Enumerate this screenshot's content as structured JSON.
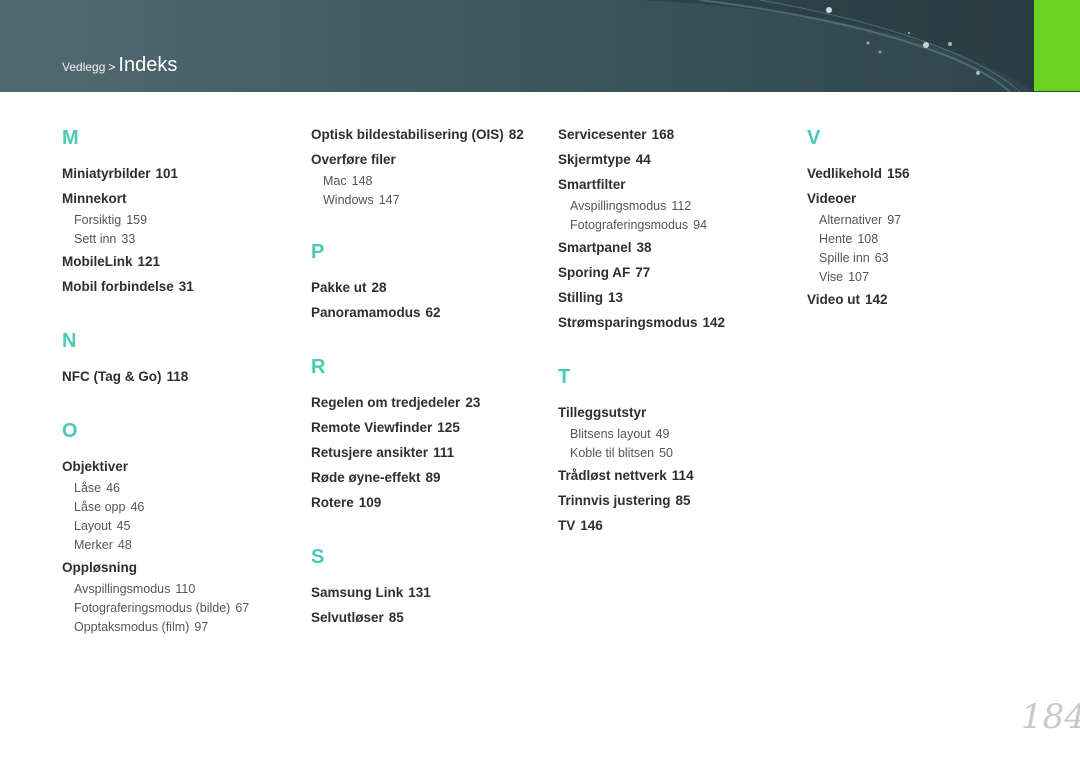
{
  "header": {
    "crumb_parent": "Vedlegg",
    "crumb_sep": ">",
    "crumb_current": "Indeks"
  },
  "page_number": "184",
  "columns": [
    [
      {
        "letter": "M"
      },
      {
        "term": "Miniatyrbilder",
        "page": "101"
      },
      {
        "term": "Minnekort",
        "page": ""
      },
      {
        "sub": "Forsiktig",
        "page": "159"
      },
      {
        "sub": "Sett inn",
        "page": "33"
      },
      {
        "term": "MobileLink",
        "page": "121"
      },
      {
        "term": "Mobil forbindelse",
        "page": "31"
      },
      {
        "letter": "N"
      },
      {
        "term": "NFC (Tag & Go)",
        "page": "118"
      },
      {
        "letter": "O"
      },
      {
        "term": "Objektiver",
        "page": ""
      },
      {
        "sub": "Låse",
        "page": "46"
      },
      {
        "sub": "Låse opp",
        "page": "46"
      },
      {
        "sub": "Layout",
        "page": "45"
      },
      {
        "sub": "Merker",
        "page": "48"
      },
      {
        "term": "Oppløsning",
        "page": ""
      },
      {
        "sub": "Avspillingsmodus",
        "page": "110"
      },
      {
        "sub": "Fotograferingsmodus (bilde)",
        "page": "67"
      },
      {
        "sub": "Opptaksmodus (film)",
        "page": "97"
      }
    ],
    [
      {
        "term": "Optisk bildestabilisering (OIS)",
        "page": "82"
      },
      {
        "term": "Overføre filer",
        "page": ""
      },
      {
        "sub": "Mac",
        "page": "148"
      },
      {
        "sub": "Windows",
        "page": "147"
      },
      {
        "letter": "P"
      },
      {
        "term": "Pakke ut",
        "page": "28"
      },
      {
        "term": "Panoramamodus",
        "page": "62"
      },
      {
        "letter": "R"
      },
      {
        "term": "Regelen om tredjedeler",
        "page": "23"
      },
      {
        "term": "Remote Viewfinder",
        "page": "125"
      },
      {
        "term": "Retusjere ansikter",
        "page": "111"
      },
      {
        "term": "Røde øyne-effekt",
        "page": "89"
      },
      {
        "term": "Rotere",
        "page": "109"
      },
      {
        "letter": "S"
      },
      {
        "term": "Samsung Link",
        "page": "131"
      },
      {
        "term": "Selvutløser",
        "page": "85"
      }
    ],
    [
      {
        "term": "Servicesenter",
        "page": "168"
      },
      {
        "term": "Skjermtype",
        "page": "44"
      },
      {
        "term": "Smartfilter",
        "page": ""
      },
      {
        "sub": "Avspillingsmodus",
        "page": "112"
      },
      {
        "sub": "Fotograferingsmodus",
        "page": "94"
      },
      {
        "term": "Smartpanel",
        "page": "38"
      },
      {
        "term": "Sporing AF",
        "page": "77"
      },
      {
        "term": "Stilling",
        "page": "13"
      },
      {
        "term": "Strømsparingsmodus",
        "page": "142"
      },
      {
        "letter": "T"
      },
      {
        "term": "Tilleggsutstyr",
        "page": ""
      },
      {
        "sub": "Blitsens layout",
        "page": "49"
      },
      {
        "sub": "Koble til blitsen",
        "page": "50"
      },
      {
        "term": "Trådløst nettverk",
        "page": "114"
      },
      {
        "term": "Trinnvis justering",
        "page": "85"
      },
      {
        "term": "TV",
        "page": "146"
      }
    ],
    [
      {
        "letter": "V"
      },
      {
        "term": "Vedlikehold",
        "page": "156"
      },
      {
        "term": "Videoer",
        "page": ""
      },
      {
        "sub": "Alternativer",
        "page": "97"
      },
      {
        "sub": "Hente",
        "page": "108"
      },
      {
        "sub": "Spille inn",
        "page": "63"
      },
      {
        "sub": "Vise",
        "page": "107"
      },
      {
        "term": "Video ut",
        "page": "142"
      }
    ]
  ]
}
